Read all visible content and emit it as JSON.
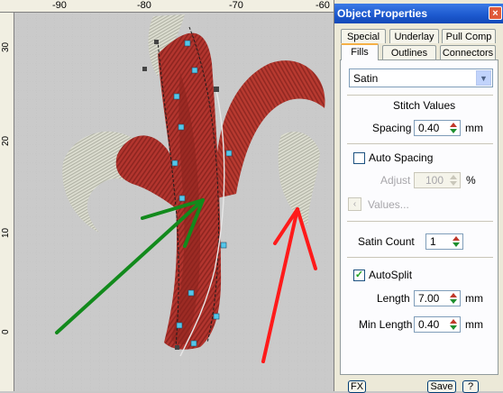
{
  "canvas": {
    "ruler_top_labels": [
      "-90",
      "-80",
      "-70",
      "-60"
    ],
    "ruler_left_labels": [
      "30",
      "20",
      "10",
      "0"
    ]
  },
  "panel": {
    "title": "Object Properties",
    "close_glyph": "×",
    "tabs_row1": [
      "Special",
      "Underlay",
      "Pull Comp"
    ],
    "tabs_row2": [
      "Fills",
      "Outlines",
      "Connectors"
    ],
    "active_tab": "Fills",
    "fill_type": "Satin",
    "stitch_values_heading": "Stitch Values",
    "spacing_label": "Spacing",
    "spacing_value": "0.40",
    "spacing_unit": "mm",
    "auto_spacing_label": "Auto Spacing",
    "auto_spacing_checked": false,
    "adjust_label": "Adjust",
    "adjust_value": "100",
    "adjust_unit": "%",
    "values_label": "Values...",
    "satin_count_label": "Satin Count",
    "satin_count_value": "1",
    "autosplit_label": "AutoSplit",
    "autosplit_checked": true,
    "length_label": "Length",
    "length_value": "7.00",
    "length_unit": "mm",
    "min_length_label": "Min Length",
    "min_length_value": "0.40",
    "min_length_unit": "mm",
    "fx_label": "FX",
    "save_label": "Save",
    "help_label": "?"
  },
  "colors": {
    "satin_red": "#b3352e",
    "satin_dark_red": "#7e1f1b",
    "satin_white": "#dcdcd0",
    "green_arrow": "#128a1c",
    "red_arrow": "#ff1a1a",
    "node_cyan": "#55c6ea"
  }
}
